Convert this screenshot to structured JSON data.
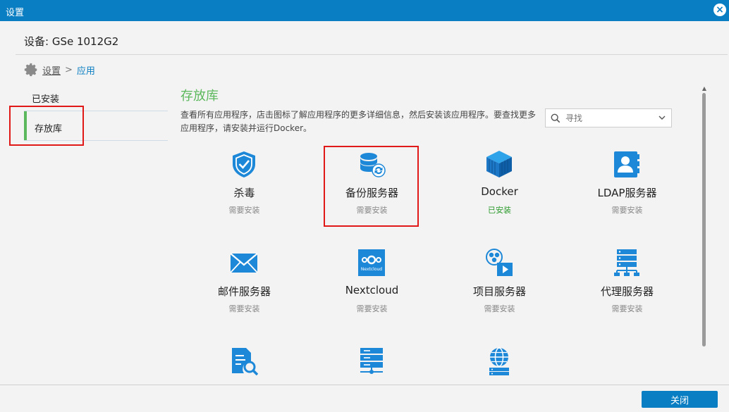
{
  "window": {
    "title": "设置"
  },
  "device": {
    "label": "设备: GSe 1012G2"
  },
  "breadcrumb": {
    "root": "设置",
    "sep": ">",
    "current": "应用"
  },
  "sidebar": {
    "items": [
      {
        "label": "已安装"
      },
      {
        "label": "存放库"
      }
    ]
  },
  "main": {
    "title": "存放库",
    "description": "查看所有应用程序，店击图标了解应用程序的更多详细信息，然后安装该应用程序。要查找更多应用程序，请安装并运行Docker。",
    "search": {
      "placeholder": "寻找"
    }
  },
  "apps": [
    {
      "name": "杀毒",
      "status": "需要安装",
      "icon": "shield-icon"
    },
    {
      "name": "备份服务器",
      "status": "需要安装",
      "icon": "database-backup-icon"
    },
    {
      "name": "Docker",
      "status": "已安装",
      "icon": "docker-cube-icon"
    },
    {
      "name": "LDAP服务器",
      "status": "需要安装",
      "icon": "address-book-icon"
    },
    {
      "name": "邮件服务器",
      "status": "需要安装",
      "icon": "mail-icon"
    },
    {
      "name": "Nextcloud",
      "status": "需要安装",
      "icon": "nextcloud-icon",
      "icon_text": "Nextcloud"
    },
    {
      "name": "项目服务器",
      "status": "需要安装",
      "icon": "project-server-icon"
    },
    {
      "name": "代理服务器",
      "status": "需要安装",
      "icon": "proxy-server-icon"
    },
    {
      "name": "",
      "status": "",
      "icon": "document-search-icon"
    },
    {
      "name": "",
      "status": "",
      "icon": "server-stack-icon"
    },
    {
      "name": "",
      "status": "",
      "icon": "globe-server-icon"
    }
  ],
  "footer": {
    "close_label": "关闭"
  },
  "colors": {
    "titlebar": "#0a7ec2",
    "accent_green": "#5cb85c",
    "icon_blue": "#1e88d8",
    "highlight_red": "#e01818"
  }
}
